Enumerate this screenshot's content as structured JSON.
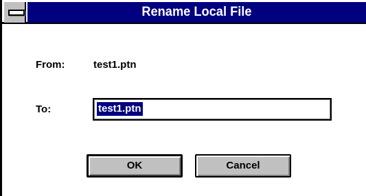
{
  "dialog": {
    "title": "Rename Local File",
    "from_label": "From:",
    "from_value": "test1.ptn",
    "to_label": "To:",
    "to_value": "test1.ptn",
    "ok_label": "OK",
    "cancel_label": "Cancel"
  },
  "colors": {
    "titlebar": "#000080",
    "selection": "#000080",
    "button_face": "#c0c0c0"
  },
  "icons": {
    "system_menu": "system-menu-icon"
  }
}
